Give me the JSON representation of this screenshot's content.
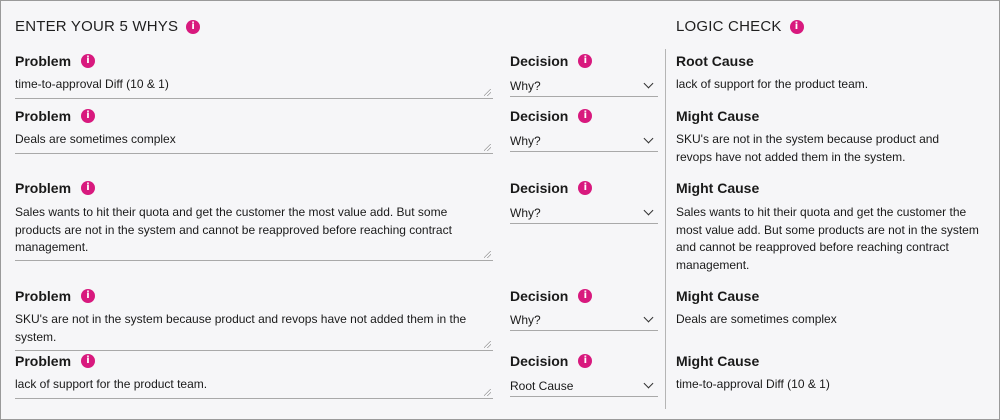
{
  "header": {
    "left_title": "ENTER YOUR 5 WHYS",
    "right_title": "LOGIC CHECK"
  },
  "rows": [
    {
      "problem_label": "Problem",
      "problem_text": "time-to-approval Diff (10 & 1)",
      "decision_label": "Decision",
      "decision_value": "Why?",
      "cause_label": "Root Cause",
      "cause_text": "lack of support for the product team."
    },
    {
      "problem_label": "Problem",
      "problem_text": "Deals are sometimes complex",
      "decision_label": "Decision",
      "decision_value": "Why?",
      "cause_label": "Might Cause",
      "cause_text": "SKU's are not in the system because product and revops have not added them in the system."
    },
    {
      "problem_label": "Problem",
      "problem_text": "Sales wants to hit their quota and get the customer the most value add. But some products are not in the system and cannot be reapproved before reaching contract management.",
      "decision_label": "Decision",
      "decision_value": "Why?",
      "cause_label": "Might Cause",
      "cause_text": "Sales wants to hit their quota and get the customer the most value add. But some products are not in the system and cannot be reapproved before reaching contract management."
    },
    {
      "problem_label": "Problem",
      "problem_text": "SKU's are not in the system because product and revops have not added them in the system.",
      "decision_label": "Decision",
      "decision_value": "Why?",
      "cause_label": "Might Cause",
      "cause_text": "Deals are sometimes complex"
    },
    {
      "problem_label": "Problem",
      "problem_text": "lack of support for the product team.",
      "decision_label": "Decision",
      "decision_value": "Root Cause",
      "cause_label": "Might Cause",
      "cause_text": "time-to-approval Diff (10 & 1)"
    }
  ],
  "icons": {
    "info": "info-icon",
    "chevron": "chevron-down-icon"
  },
  "colors": {
    "accent": "#d8197e",
    "background": "#f6f6f8",
    "text": "#1a1a1a"
  }
}
